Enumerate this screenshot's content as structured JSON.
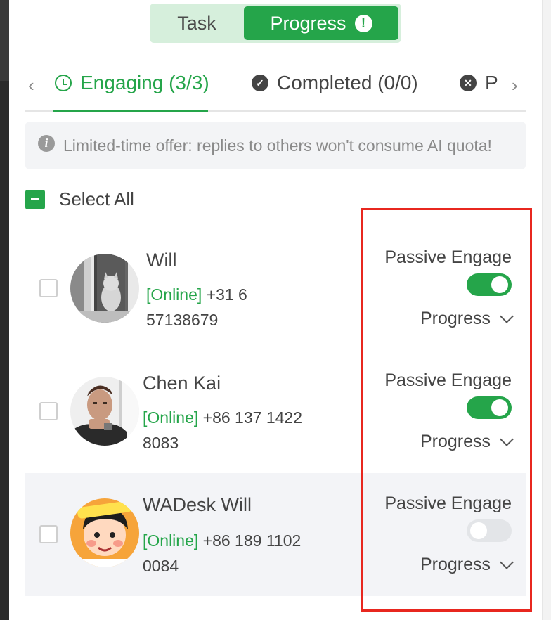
{
  "header": {
    "tabs": [
      {
        "label": "Task",
        "active": false
      },
      {
        "label": "Progress",
        "active": true,
        "badge": "!"
      }
    ]
  },
  "status_tabs": {
    "prev_arrow": "‹",
    "next_arrow": "›",
    "items": [
      {
        "label": "Engaging (3/3)",
        "icon": "clock-icon",
        "active": true
      },
      {
        "label": "Completed (0/0)",
        "icon": "check-circle-icon",
        "active": false
      },
      {
        "label": "P",
        "icon": "close-circle-icon",
        "active": false
      }
    ]
  },
  "notice": {
    "icon": "info-icon",
    "text": "Limited-time offer: replies to others won't consume AI quota!"
  },
  "select_all": {
    "label": "Select All",
    "state": "indeterminate"
  },
  "contacts": [
    {
      "name": "Will",
      "status": "[Online]",
      "phone_line1": " +31 6",
      "phone_line2": "57138679",
      "engage_label": "Passive Engage",
      "engage_on": true,
      "dropdown_label": "Progress"
    },
    {
      "name": "Chen Kai",
      "status": "[Online]",
      "phone_line1": " +86 137 1422",
      "phone_line2": "8083",
      "engage_label": "Passive Engage",
      "engage_on": true,
      "dropdown_label": "Progress"
    },
    {
      "name": "WADesk Will",
      "status": "[Online]",
      "phone_line1": " +86 189 1102",
      "phone_line2": "0084",
      "engage_label": "Passive Engage",
      "engage_on": false,
      "dropdown_label": "Progress"
    }
  ],
  "colors": {
    "accent": "#25a54a",
    "accent_light": "#d6efdc",
    "highlight_box": "#e8271f",
    "toggle_off": "#e3e5e8"
  }
}
